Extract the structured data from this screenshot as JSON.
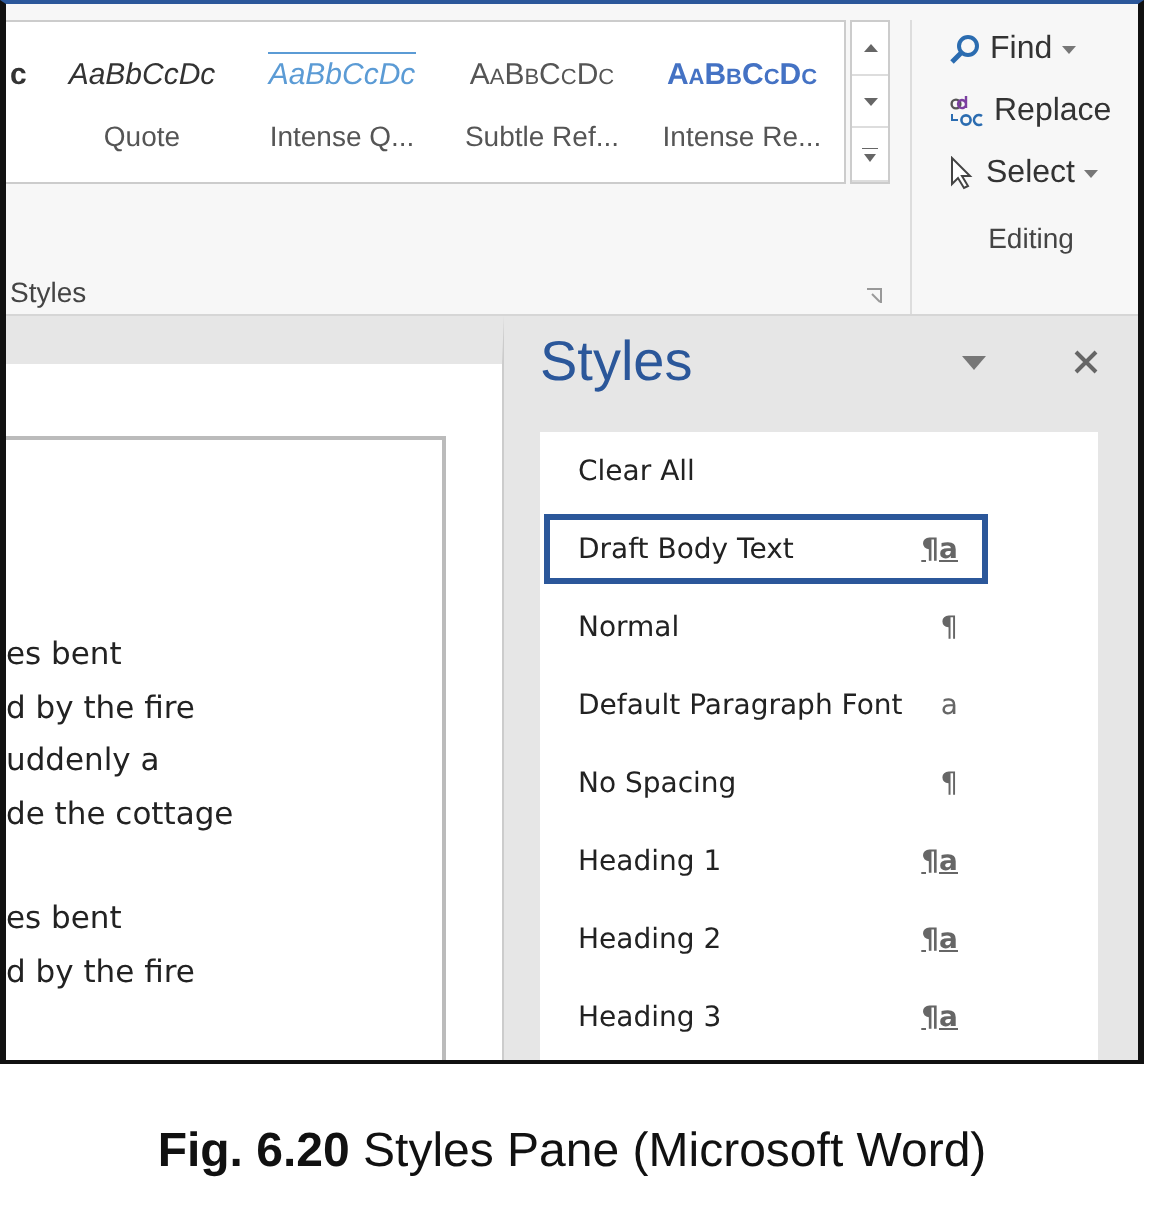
{
  "ribbon": {
    "gallery": [
      {
        "kind": "cut",
        "sample": "c"
      },
      {
        "kind": "quote",
        "sample": "AaBbCcDc",
        "label": "Quote"
      },
      {
        "kind": "intense-quote",
        "sample": "AaBbCcDc",
        "label": "Intense Q..."
      },
      {
        "kind": "subtle-ref",
        "sample": "AaBbCcDc",
        "label": "Subtle Ref..."
      },
      {
        "kind": "intense-ref",
        "sample": "AaBbCcDc",
        "label": "Intense Re..."
      }
    ],
    "group_label": "Styles",
    "editing": {
      "items": [
        {
          "kind": "find",
          "label": "Find",
          "dropdown": true
        },
        {
          "kind": "replace",
          "label": "Replace",
          "dropdown": false
        },
        {
          "kind": "select",
          "label": "Select",
          "dropdown": true
        }
      ],
      "group_label": "Editing"
    }
  },
  "document": {
    "paragraphs": [
      [
        "es bent",
        "d by the fire",
        "uddenly a",
        "de the cottage"
      ],
      [
        "es bent",
        "d by the fire"
      ]
    ]
  },
  "styles_pane": {
    "title": "Styles",
    "items": [
      {
        "name": "Clear All",
        "selected": false
      },
      {
        "name": "Draft Body Text",
        "kind": "linked",
        "symbol": "¶a",
        "selected": true
      },
      {
        "name": "Normal",
        "kind": "paragraph",
        "symbol": "¶",
        "selected": false
      },
      {
        "name": "Default Paragraph Font",
        "kind": "character",
        "symbol": "a",
        "selected": false
      },
      {
        "name": "No Spacing",
        "kind": "paragraph",
        "symbol": "¶",
        "selected": false
      },
      {
        "name": "Heading 1",
        "kind": "linked",
        "symbol": "¶a",
        "selected": false
      },
      {
        "name": "Heading 2",
        "kind": "linked",
        "symbol": "¶a",
        "selected": false
      },
      {
        "name": "Heading 3",
        "kind": "linked",
        "symbol": "¶a",
        "selected": false
      }
    ]
  },
  "caption": "**Fig. 6.20** Styles Pane (Microsoft Word)"
}
